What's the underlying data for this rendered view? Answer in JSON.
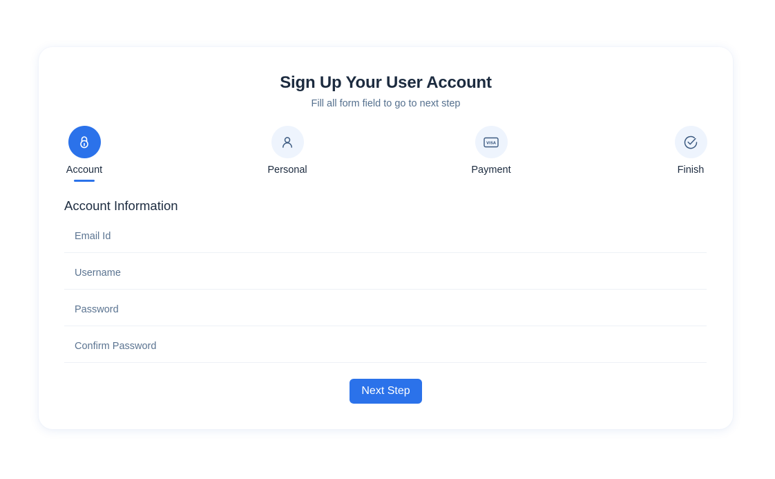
{
  "header": {
    "title": "Sign Up Your User Account",
    "subtitle": "Fill all form field to go to next step"
  },
  "steps": [
    {
      "label": "Account",
      "icon": "lock-icon",
      "active": true
    },
    {
      "label": "Personal",
      "icon": "user-icon",
      "active": false
    },
    {
      "label": "Payment",
      "icon": "visa-card-icon",
      "icon_text": "VISA",
      "active": false
    },
    {
      "label": "Finish",
      "icon": "check-circle-icon",
      "active": false
    }
  ],
  "form": {
    "section_title": "Account Information",
    "fields": [
      {
        "placeholder": "Email Id",
        "value": ""
      },
      {
        "placeholder": "Username",
        "value": ""
      },
      {
        "placeholder": "Password",
        "value": ""
      },
      {
        "placeholder": "Confirm Password",
        "value": ""
      }
    ],
    "next_label": "Next Step"
  },
  "colors": {
    "accent": "#2b72ea",
    "icon_bg": "#eef4fd",
    "text_dark": "#1c2b3f",
    "text_muted": "#55708e"
  }
}
